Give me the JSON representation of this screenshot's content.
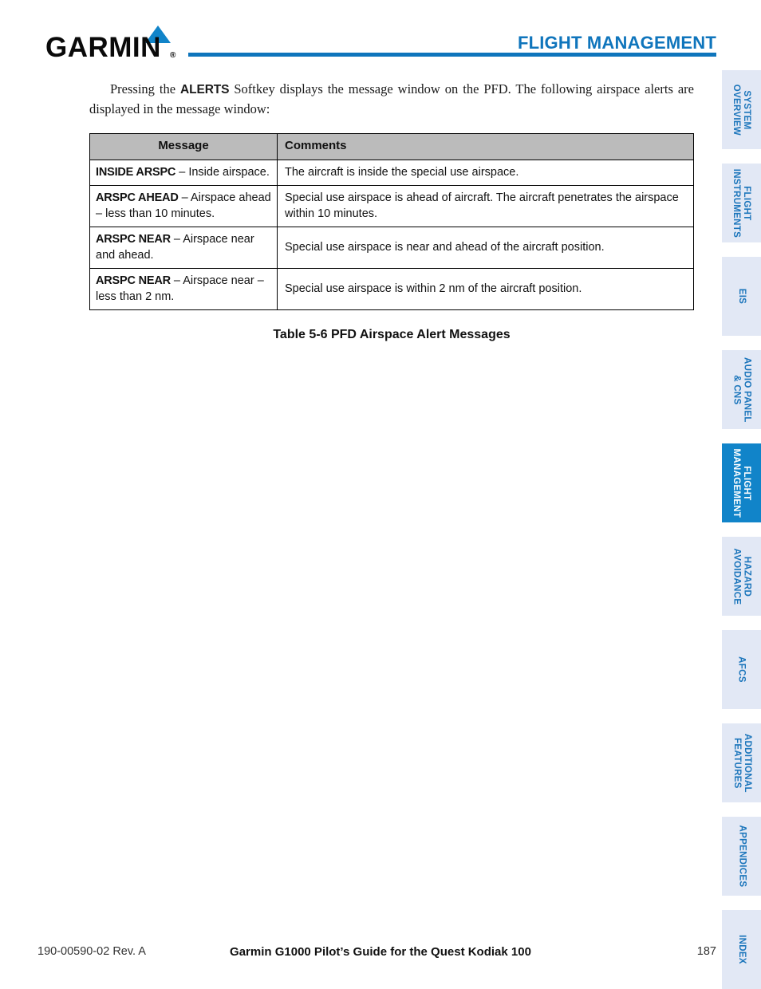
{
  "header": {
    "brand": "GARMIN",
    "brand_mark": "registered-trademark",
    "registered_symbol": "®",
    "title": "FLIGHT MANAGEMENT",
    "rule_color": "#0F75BC",
    "accent_color": "#1184C9"
  },
  "body": {
    "paragraph_part1": "Pressing the ",
    "paragraph_softkey": "ALERTS",
    "paragraph_part2": " Softkey displays the message window on the PFD. The following airspace alerts are displayed in the message window:"
  },
  "table": {
    "columns": [
      "Message",
      "Comments"
    ],
    "header_bg": "#BBBBBB",
    "rows": [
      {
        "code": "INSIDE ARSPC",
        "message_rest": " – Inside airspace.",
        "comments": "The aircraft is inside the special use airspace."
      },
      {
        "code": "ARSPC AHEAD",
        "message_rest": " – Airspace ahead – less than 10 minutes.",
        "comments": "Special use airspace is ahead of aircraft.  The aircraft penetrates the airspace within 10 minutes."
      },
      {
        "code": "ARSPC NEAR",
        "message_rest": " – Airspace near and ahead.",
        "comments": "Special use airspace is near and ahead of the aircraft position."
      },
      {
        "code": "ARSPC NEAR",
        "message_rest": " – Airspace near – less than 2 nm.",
        "comments": "Special use airspace is within 2 nm of the aircraft position."
      }
    ],
    "caption": "Table 5-6  PFD Airspace Alert Messages"
  },
  "tab_rail": {
    "inactive_bg": "#E2E8F5",
    "active_bg": "#1184C9",
    "inactive_text": "#1B75BB",
    "active_text": "#FFFFFF",
    "items": [
      {
        "label": "SYSTEM\nOVERVIEW",
        "active": false
      },
      {
        "label": "FLIGHT\nINSTRUMENTS",
        "active": false
      },
      {
        "label": "EIS",
        "active": false
      },
      {
        "label": "AUDIO PANEL\n& CNS",
        "active": false
      },
      {
        "label": "FLIGHT\nMANAGEMENT",
        "active": true
      },
      {
        "label": "HAZARD\nAVOIDANCE",
        "active": false
      },
      {
        "label": "AFCS",
        "active": false
      },
      {
        "label": "ADDITIONAL\nFEATURES",
        "active": false
      },
      {
        "label": "APPENDICES",
        "active": false
      },
      {
        "label": "INDEX",
        "active": false
      }
    ]
  },
  "footer": {
    "doc_number": "190-00590-02  Rev. A",
    "title": "Garmin G1000 Pilot’s Guide for the Quest Kodiak 100",
    "page_number": "187"
  }
}
